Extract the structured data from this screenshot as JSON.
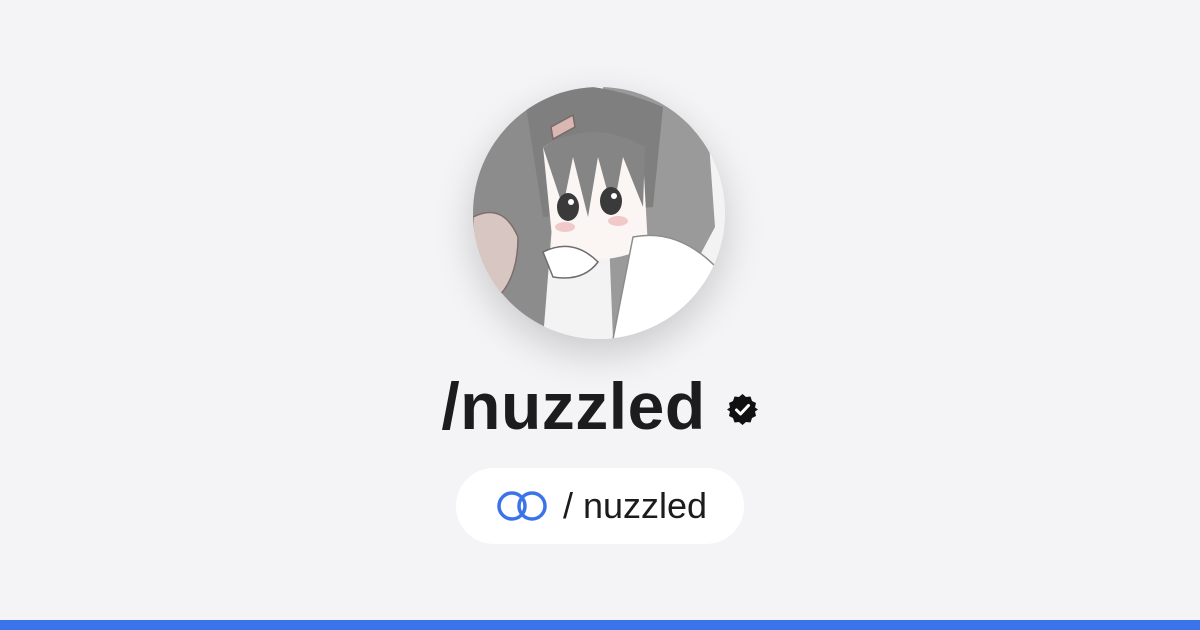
{
  "profile": {
    "display_name": "/nuzzled",
    "verified": true,
    "avatar_icon": "anime-girl-avatar-image"
  },
  "link_pill": {
    "icon": "linked-rings-icon",
    "text": "/ nuzzled"
  },
  "colors": {
    "accent": "#3b74ea",
    "background": "#f4f4f6",
    "text": "#1c1c1e"
  }
}
